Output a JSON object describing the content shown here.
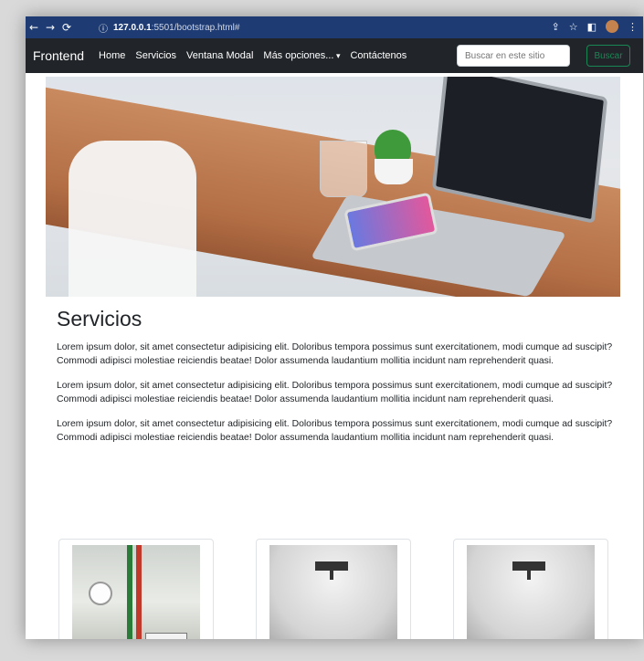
{
  "browser": {
    "url_host": "127.0.0.1",
    "url_path": ":5501/bootstrap.html#",
    "info_icon": "info-icon"
  },
  "navbar": {
    "brand": "Frontend",
    "links": [
      "Home",
      "Servicios",
      "Ventana Modal",
      "Más opciones...",
      "Contáctenos"
    ],
    "search_placeholder": "Buscar en este sitio",
    "search_button": "Buscar"
  },
  "main": {
    "title": "Servicios",
    "paragraphs": [
      "Lorem ipsum dolor, sit amet consectetur adipisicing elit. Doloribus tempora possimus sunt exercitationem, modi cumque ad suscipit? Commodi adipisci molestiae reiciendis beatae! Dolor assumenda laudantium mollitia incidunt nam reprehenderit quasi.",
      "Lorem ipsum dolor, sit amet consectetur adipisicing elit. Doloribus tempora possimus sunt exercitationem, modi cumque ad suscipit? Commodi adipisci molestiae reiciendis beatae! Dolor assumenda laudantium mollitia incidunt nam reprehenderit quasi.",
      "Lorem ipsum dolor, sit amet consectetur adipisicing elit. Doloribus tempora possimus sunt exercitationem, modi cumque ad suscipit? Commodi adipisci molestiae reiciendis beatae! Dolor assumenda laudantium mollitia incidunt nam reprehenderit quasi."
    ]
  },
  "colors": {
    "chrome_bar": "#1e3c73",
    "navbar": "#212529",
    "success": "#198754"
  }
}
